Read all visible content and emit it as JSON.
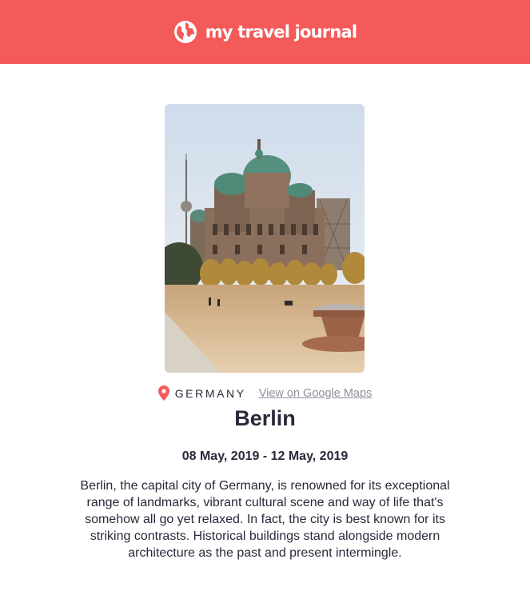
{
  "header": {
    "brand": "my travel journal",
    "icon": "globe-icon",
    "background_color": "#f55a5a"
  },
  "entry": {
    "image": "berlin-cathedral-photo",
    "location_icon": "map-pin-icon",
    "country": "GERMANY",
    "maps_link": "View on Google Maps",
    "title": "Berlin",
    "dates": "08 May, 2019 - 12 May, 2019",
    "description": "Berlin, the capital city of Germany, is renowned for its exceptional range of landmarks, vibrant cultural scene and way of life that's somehow all go yet relaxed. In fact, the city is best known for its striking contrasts. Historical buildings stand alongside modern architecture as the past and present intermingle."
  }
}
